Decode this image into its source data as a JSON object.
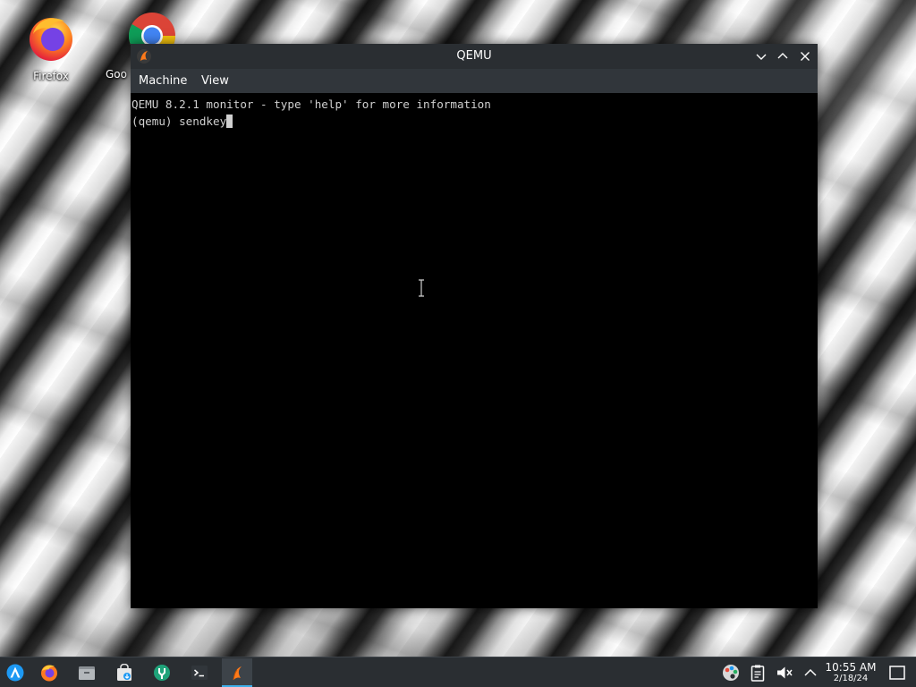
{
  "desktop": {
    "icons": [
      {
        "label": "Firefox",
        "icon": "firefox-icon"
      },
      {
        "label": "Goo",
        "icon": "chrome-icon"
      }
    ]
  },
  "window": {
    "title": "QEMU",
    "app_icon": "qemu-icon",
    "controls": [
      "minimize-icon",
      "maximize-icon",
      "close-icon"
    ],
    "menu": [
      {
        "label": "Machine"
      },
      {
        "label": "View"
      }
    ],
    "console": {
      "lines": [
        "QEMU 8.2.1 monitor - type 'help' for more information",
        "(qemu) sendkey"
      ]
    }
  },
  "taskbar": {
    "launcher_icon": "app-launcher-icon",
    "pinned": [
      {
        "name": "firefox",
        "icon": "firefox-icon"
      },
      {
        "name": "file-manager",
        "icon": "file-manager-icon"
      },
      {
        "name": "software-store",
        "icon": "shopping-bag-icon"
      },
      {
        "name": "settings",
        "icon": "system-settings-icon"
      },
      {
        "name": "terminal",
        "icon": "terminal-icon"
      },
      {
        "name": "qemu",
        "icon": "qemu-icon",
        "active": true
      }
    ],
    "tray": [
      "palette-icon",
      "clipboard-icon",
      "volume-muted-icon",
      "chevron-up-icon"
    ],
    "clock": {
      "time": "10:55 AM",
      "date": "2/18/24"
    },
    "show_desktop_icon": "show-desktop-icon"
  },
  "colors": {
    "titlebar": "#2a2e32",
    "menubar": "#31363b",
    "console_bg": "#000000",
    "console_text": "#d0d0d0",
    "accent": "#3daee9"
  }
}
